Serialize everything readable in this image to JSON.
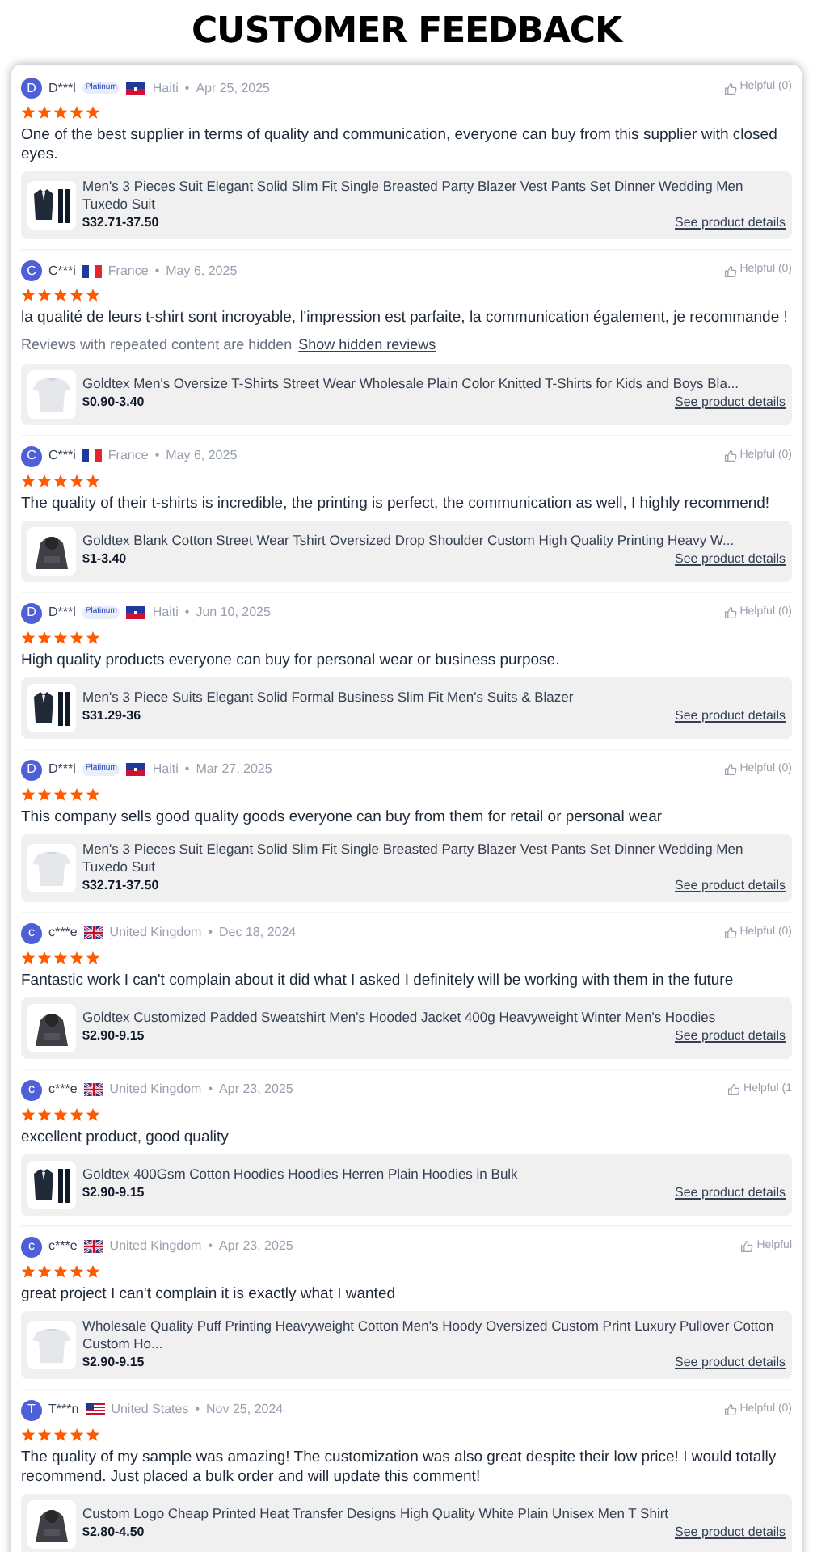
{
  "title": "CUSTOMER FEEDBACK",
  "reviews": [
    {
      "avatar": "D",
      "name": "D***l",
      "badge": "Platinum",
      "flag": {
        "kind": "haiti"
      },
      "country": "Haiti",
      "dot": "•",
      "date": "Apr 25, 2025",
      "helpful": "Helpful (0)",
      "stars": 5,
      "text": "One of the best supplier in terms of quality and communication, everyone can buy from this supplier with closed eyes.",
      "product": {
        "title": "Men's 3 Pieces Suit Elegant Solid Slim Fit Single Breasted Party Blazer Vest Pants Set Dinner Wedding Men Tuxedo Suit",
        "price": "$32.71-37.50",
        "link": "See product details"
      }
    },
    {
      "avatar": "C",
      "name": "C***i",
      "flag": {
        "kind": "france"
      },
      "country": "France",
      "dot": "•",
      "date": "May 6, 2025",
      "helpful": "Helpful (0)",
      "stars": 5,
      "text": "la qualité de leurs t-shirt sont incroyable, l'impression est parfaite, la communication également, je recommande !",
      "hidden_note": {
        "text": "Reviews with repeated content are hidden",
        "link": "Show hidden reviews"
      },
      "product": {
        "title": "Goldtex Men's Oversize T-Shirts Street Wear Wholesale Plain Color Knitted T-Shirts for Kids and Boys Bla...",
        "price": "$0.90-3.40",
        "link": "See product details"
      }
    },
    {
      "avatar": "C",
      "name": "C***i",
      "flag": {
        "kind": "france"
      },
      "country": "France",
      "dot": "•",
      "date": "May 6, 2025",
      "helpful": "Helpful (0)",
      "stars": 5,
      "text": "The quality of their t-shirts is incredible, the printing is perfect, the communication as well, I highly recommend!",
      "product": {
        "title": "Goldtex Blank Cotton Street Wear Tshirt Oversized Drop Shoulder Custom High Quality Printing Heavy W...",
        "price": "$1-3.40",
        "link": "See product details"
      }
    },
    {
      "avatar": "D",
      "name": "D***l",
      "badge": "Platinum",
      "flag": {
        "kind": "haiti"
      },
      "country": "Haiti",
      "dot": "•",
      "date": "Jun 10, 2025",
      "helpful": "Helpful (0)",
      "stars": 5,
      "text": "High quality products everyone can buy for personal wear or business purpose.",
      "product": {
        "title": "Men's 3 Piece Suits Elegant Solid Formal Business Slim Fit Men's Suits & Blazer",
        "price": "$31.29-36",
        "link": "See product details"
      }
    },
    {
      "avatar": "D",
      "name": "D***l",
      "badge": "Platinum",
      "flag": {
        "kind": "haiti"
      },
      "country": "Haiti",
      "dot": "•",
      "date": "Mar 27, 2025",
      "helpful": "Helpful (0)",
      "stars": 5,
      "text": "This company sells good quality goods everyone can buy from them for retail or personal wear",
      "product": {
        "title": "Men's 3 Pieces Suit Elegant Solid Slim Fit Single Breasted Party Blazer Vest Pants Set Dinner Wedding Men Tuxedo Suit",
        "price": "$32.71-37.50",
        "link": "See product details"
      }
    },
    {
      "avatar": "c",
      "name": "c***e",
      "flag": {
        "kind": "uk"
      },
      "country": "United Kingdom",
      "dot": "•",
      "date": "Dec 18, 2024",
      "helpful": "Helpful (0)",
      "stars": 5,
      "text": "Fantastic work I can't complain about it did what I asked I definitely will be working with them in the future",
      "product": {
        "title": "Goldtex Customized Padded Sweatshirt Men's Hooded Jacket 400g Heavyweight Winter Men's Hoodies",
        "price": "$2.90-9.15",
        "link": "See product details"
      }
    },
    {
      "avatar": "c",
      "name": "c***e",
      "flag": {
        "kind": "uk"
      },
      "country": "United Kingdom",
      "dot": "•",
      "date": "Apr 23, 2025",
      "helpful": "Helpful (1",
      "stars": 5,
      "text": "excellent product, good quality",
      "product": {
        "title": "Goldtex 400Gsm Cotton Hoodies Hoodies Herren Plain Hoodies in Bulk",
        "price": "$2.90-9.15",
        "link": "See product details"
      }
    },
    {
      "avatar": "c",
      "name": "c***e",
      "flag": {
        "kind": "uk"
      },
      "country": "United Kingdom",
      "dot": "•",
      "date": "Apr 23, 2025",
      "helpful": "Helpful",
      "stars": 5,
      "text": "great project I can't complain it is exactly what I wanted",
      "product": {
        "title": "Wholesale Quality Puff Printing Heavyweight Cotton Men's Hoody Oversized Custom Print Luxury Pullover Cotton Custom Ho...",
        "price": "$2.90-9.15",
        "link": "See product details"
      }
    },
    {
      "avatar": "T",
      "name": "T***n",
      "flag": {
        "kind": "us"
      },
      "country": "United States",
      "dot": "•",
      "date": "Nov 25, 2024",
      "helpful": "Helpful (0)",
      "stars": 5,
      "text": "The quality of my sample was amazing! The customization was also great despite their low price! I would totally recommend. Just placed a bulk order and will update this comment!",
      "product": {
        "title": "Custom Logo Cheap Printed Heat Transfer Designs High Quality White Plain Unisex Men T Shirt",
        "price": "$2.80-4.50",
        "link": "See product details"
      }
    }
  ]
}
